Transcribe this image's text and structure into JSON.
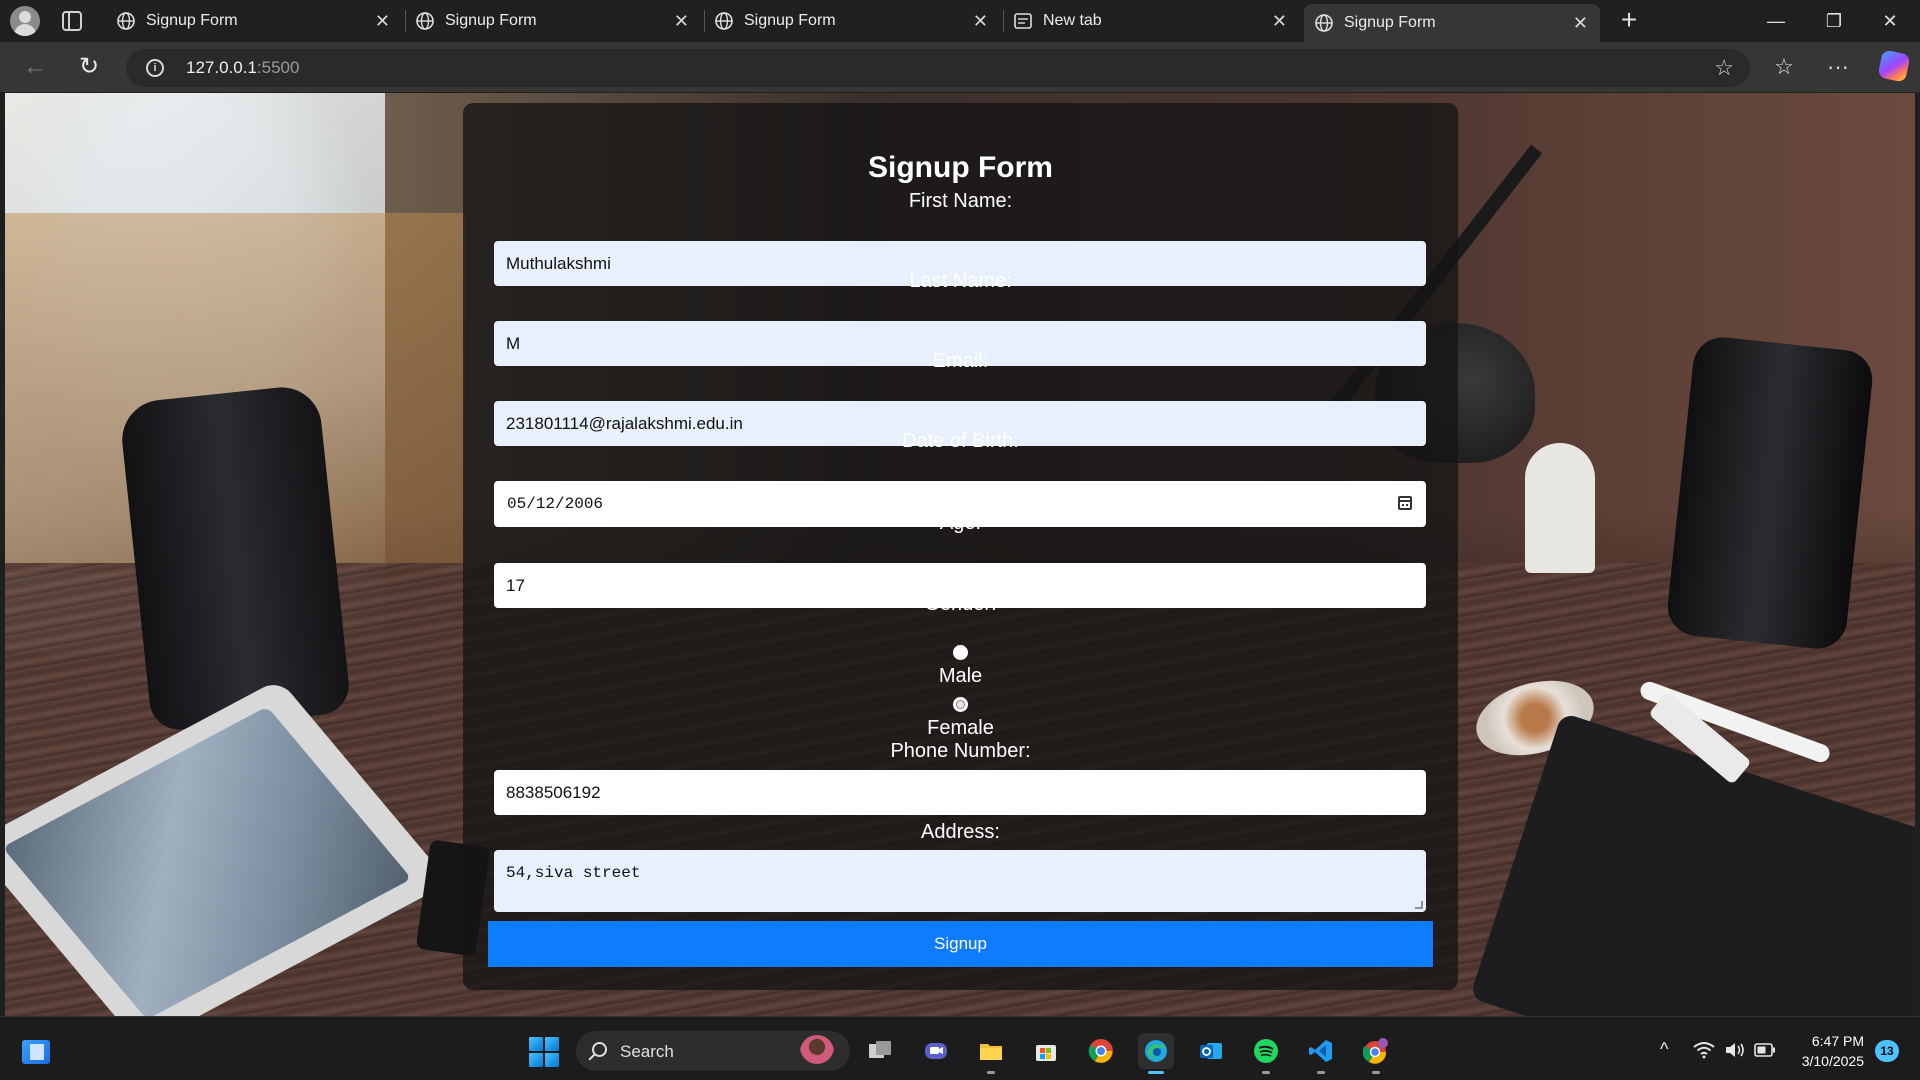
{
  "browser": {
    "tabs": [
      {
        "label": "Signup Form",
        "icon": "globe-icon",
        "active": false
      },
      {
        "label": "Signup Form",
        "icon": "globe-icon",
        "active": false
      },
      {
        "label": "Signup Form",
        "icon": "globe-icon",
        "active": false
      },
      {
        "label": "New tab",
        "icon": "newtab-page-icon",
        "active": false
      },
      {
        "label": "Signup Form",
        "icon": "globe-icon",
        "active": true
      }
    ],
    "close_glyph": "✕",
    "new_tab_glyph": "+",
    "window_controls": {
      "minimize": "—",
      "restore": "❐",
      "close": "✕"
    },
    "address": {
      "host": "127.0.0.1",
      "port": ":5500"
    },
    "nav": {
      "back": "←",
      "reload": "↻"
    },
    "toolbar": {
      "favorite": "☆",
      "favorites_list": "☆",
      "more": "···"
    }
  },
  "form": {
    "title": "Signup Form",
    "first_name": {
      "label": "First Name:",
      "value": "Muthulakshmi"
    },
    "last_name": {
      "label": "Last Name:",
      "value": "M"
    },
    "email": {
      "label": "Email:",
      "value": "231801114@rajalakshmi.edu.in"
    },
    "dob": {
      "label": "Date of Birth:",
      "value": "05/12/2006"
    },
    "age": {
      "label": "Age:",
      "value": "17"
    },
    "gender": {
      "label": "Gender:",
      "options": [
        {
          "label": "Male",
          "selected": false
        },
        {
          "label": "Female",
          "selected": false
        }
      ]
    },
    "phone": {
      "label": "Phone Number:",
      "value": "8838506192"
    },
    "address": {
      "label": "Address:",
      "value": "54,siva street"
    },
    "submit_label": "Signup",
    "button_color": "#0f7bff"
  },
  "taskbar": {
    "search_label": "Search",
    "apps": [
      "task-view",
      "chat",
      "file-explorer",
      "microsoft-store",
      "chrome",
      "edge",
      "outlook",
      "spotify",
      "vscode",
      "chrome-profile"
    ],
    "clock": {
      "time": "6:47 PM",
      "date": "3/10/2025"
    },
    "notification_count": "13",
    "tray": {
      "overflow": "^"
    }
  }
}
